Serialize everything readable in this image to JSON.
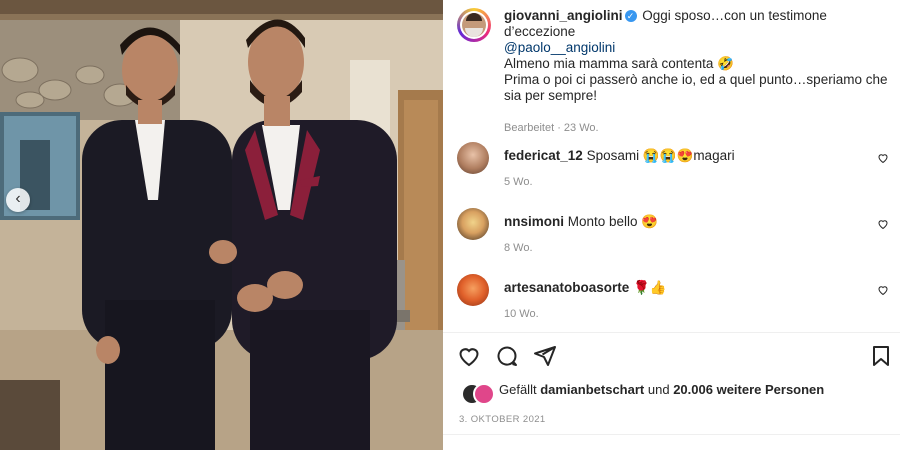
{
  "post": {
    "username": "giovanni_angiolini",
    "caption_line1": "Oggi sposo…con un testimone d’eccezione",
    "mention": "@paolo__angiolini",
    "caption_line2": "Almeno mia mamma sarà contenta",
    "caption_emoji": "🤣",
    "caption_line3": "Prima o poi ci passerò anche io, ed a quel punto…speriamo che sia per sempre!",
    "edited": "Bearbeitet · 23 Wo."
  },
  "comments": [
    {
      "username": "federicat_12",
      "text": "Sposami",
      "emojis": "😭😭😍",
      "text_after": "magari",
      "time": "5 Wo."
    },
    {
      "username": "nnsimoni",
      "text": "Monto bello",
      "emojis": "😍",
      "text_after": "",
      "time": "8 Wo."
    },
    {
      "username": "artesanatoboasorte",
      "text": "",
      "emojis": "🌹👍",
      "text_after": "",
      "time": "10 Wo."
    }
  ],
  "likes": {
    "prefix": "Gefällt",
    "user": "damianbetschart",
    "middle": "und",
    "count": "20.006 weitere Personen"
  },
  "date": "3. OKTOBER 2021",
  "icons": {
    "like": "heart-icon",
    "comment": "comment-icon",
    "share": "send-icon",
    "save": "bookmark-icon",
    "prev": "chevron-left-icon"
  },
  "colors": {
    "verified": "#3897f0",
    "mention": "#00376b",
    "suit_accent": "#8b1f3a"
  }
}
